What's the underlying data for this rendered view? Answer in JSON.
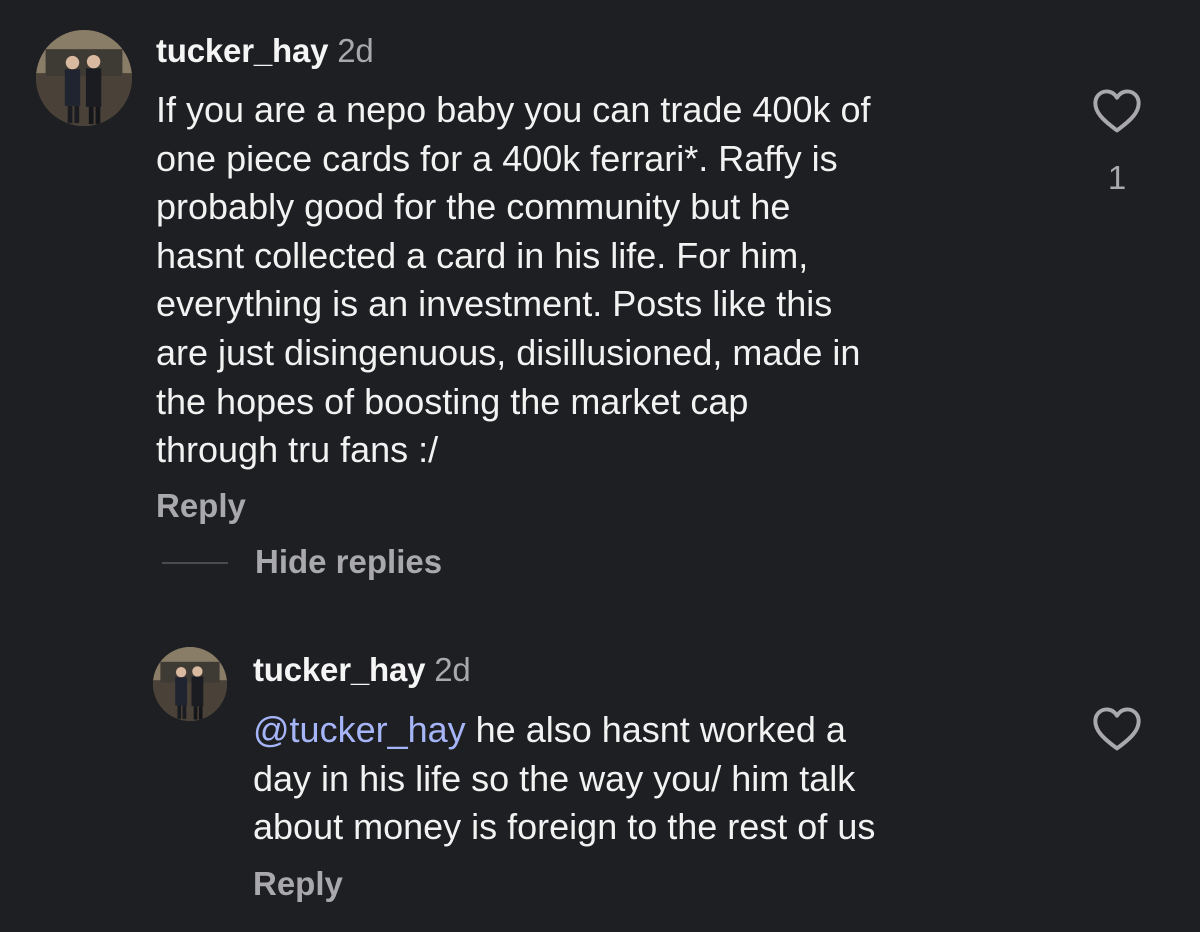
{
  "comments": [
    {
      "username": "tucker_hay",
      "time": "2d",
      "lines": [
        "If you are a nepo baby you can trade 400k of",
        "one piece cards for a 400k ferrari*. Raffy is",
        "probably good for the community but he",
        "hasnt collected a card in his life. For him,",
        "everything is an investment. Posts like this",
        "are just disingenuous, disillusioned, made in",
        "the hopes of boosting the market cap",
        "through tru fans :/"
      ],
      "reply_label": "Reply",
      "like_count": "1",
      "like_icon": "heart-outline-icon"
    }
  ],
  "replies_toggle": {
    "label": "Hide replies"
  },
  "replies": [
    {
      "username": "tucker_hay",
      "time": "2d",
      "mention": "@tucker_hay",
      "lines": [
        " he also hasnt worked a",
        "day in his life so the way you/ him talk",
        "about money is foreign to the rest of us"
      ],
      "reply_label": "Reply",
      "like_icon": "heart-outline-icon"
    }
  ],
  "colors": {
    "background": "#1e1f22",
    "text": "#f2f2f2",
    "secondary_text": "#a8a8ad",
    "mention": "#a6b5f8"
  }
}
